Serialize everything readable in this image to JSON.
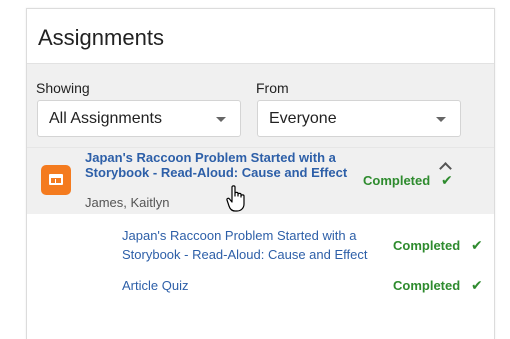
{
  "panel": {
    "title": "Assignments"
  },
  "filters": {
    "showing": {
      "label": "Showing",
      "value": "All Assignments"
    },
    "from": {
      "label": "From",
      "value": "Everyone"
    }
  },
  "assignment": {
    "title": "Japan's Raccoon Problem Started with a Storybook - Read-Aloud: Cause and Effect",
    "students": "James, Kaitlyn",
    "status": "Completed",
    "icon": "book-icon",
    "items": [
      {
        "title": "Japan's Raccoon Problem Started with a Storybook - Read-Aloud: Cause and Effect",
        "status": "Completed"
      },
      {
        "title": "Article Quiz",
        "status": "Completed"
      }
    ]
  },
  "colors": {
    "link": "#2d5fa8",
    "completed": "#2e8b2e",
    "icon_bg": "#f47b1f",
    "filter_bg": "#f0f0f0"
  }
}
